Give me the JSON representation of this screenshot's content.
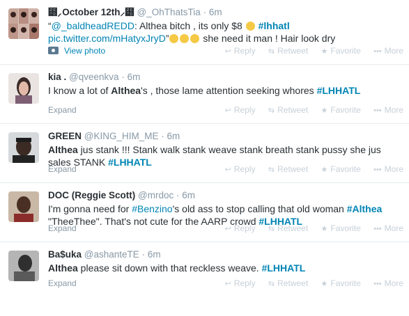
{
  "actions": {
    "reply": "Reply",
    "retweet": "Retweet",
    "favorite": "Favorite",
    "more": "More",
    "reply_icon": "reply-arrow-icon",
    "retweet_icon": "retweet-icon",
    "favorite_icon": "star-icon",
    "more_icon": "ellipsis-icon"
  },
  "tweets": [
    {
      "fullname": "⹽⸝October 12th⸝⹽",
      "username": "@_OhThatsTia",
      "time": "6m",
      "text_quote_open": "“",
      "mention": "@_baldheadREDD",
      "text_1": ": Althea bitch , its only $8 ",
      "hashtag_1": "#lhhatl",
      "link": "pic.twitter.com/mHatyxJryD",
      "text_quote_close": "”",
      "text_2": " she need it man ! Hair look dry",
      "footer_link": "View photo"
    },
    {
      "fullname": "kia .",
      "username": "@qveenkva",
      "time": "6m",
      "text_1": "I know a lot of ",
      "highlight": "Althea",
      "text_2": "'s , those lame attention seeking whores ",
      "hashtag_1": "#LHHATL",
      "footer_link": "Expand"
    },
    {
      "fullname": "GREEN",
      "username": "@KING_HIM_ME",
      "time": "6m",
      "highlight": "Althea",
      "text_1": " jus stank !!! Stank walk stank weave stank breath stank pussy  she jus sales STANK ",
      "hashtag_1": "#LHHATL",
      "footer_link": "Expand"
    },
    {
      "fullname": "DOC (Reggie Scott)",
      "username": "@mrdoc",
      "time": "6m",
      "text_1": "I'm gonna need for ",
      "hashtag_1": "#Benzino",
      "text_2": "'s old ass to stop calling that old woman ",
      "hashtag_2": "#Althea",
      "text_3": " \"TheeThee\". That's not cute for the AARP crowd ",
      "hashtag_3": "#LHHATL",
      "footer_link": "Expand"
    },
    {
      "fullname": "Ba$uka",
      "username": "@ashanteTE",
      "time": "6m",
      "highlight": "Althea",
      "text_1": " please sit down with that reckless weave. ",
      "hashtag_1": "#LHHATL",
      "footer_link": "Expand"
    }
  ]
}
